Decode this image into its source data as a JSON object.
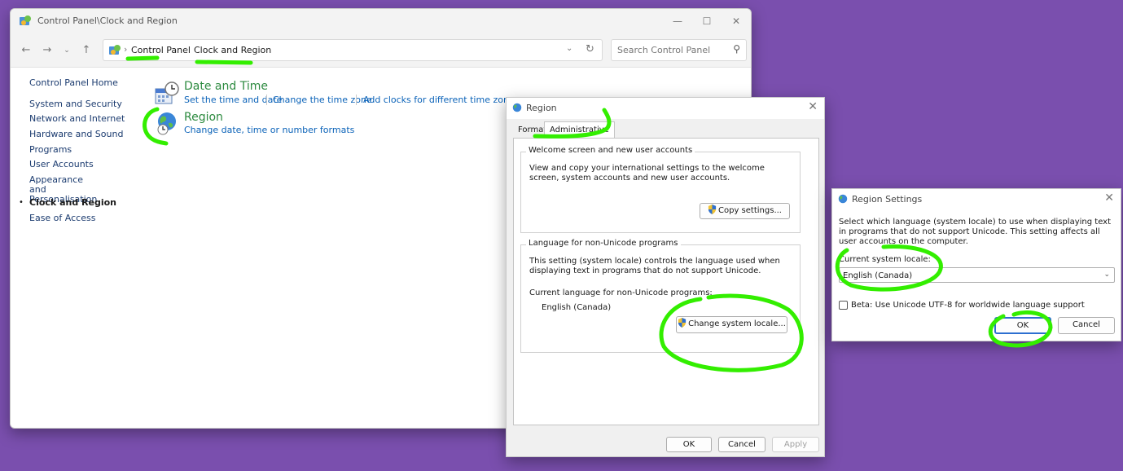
{
  "control_panel": {
    "window_title": "Control Panel\\Clock and Region",
    "breadcrumb": [
      "Control Panel",
      "Clock and Region"
    ],
    "search_placeholder": "Search Control Panel",
    "sidebar": {
      "home": "Control Panel Home",
      "items": [
        {
          "label": "System and Security"
        },
        {
          "label": "Network and Internet"
        },
        {
          "label": "Hardware and Sound"
        },
        {
          "label": "Programs"
        },
        {
          "label": "User Accounts"
        },
        {
          "label": "Appearance and Personalisation"
        },
        {
          "label": "Clock and Region"
        },
        {
          "label": "Ease of Access"
        }
      ]
    },
    "categories": [
      {
        "title": "Date and Time",
        "links": [
          "Set the time and date",
          "Change the time zone",
          "Add clocks for different time zones"
        ]
      },
      {
        "title": "Region",
        "links": [
          "Change date, time or number formats"
        ]
      }
    ]
  },
  "region_dialog": {
    "title": "Region",
    "tabs": [
      "Formats",
      "Administrative"
    ],
    "welcome_group": {
      "legend": "Welcome screen and new user accounts",
      "text": "View and copy your international settings to the welcome screen, system accounts and new user accounts.",
      "button": "Copy settings..."
    },
    "unicode_group": {
      "legend": "Language for non-Unicode programs",
      "text": "This setting (system locale) controls the language used when displaying text in programs that do not support Unicode.",
      "current_label": "Current language for non-Unicode programs:",
      "current_value": "English (Canada)",
      "button": "Change system locale..."
    },
    "buttons": {
      "ok": "OK",
      "cancel": "Cancel",
      "apply": "Apply"
    }
  },
  "region_settings": {
    "title": "Region Settings",
    "description": "Select which language (system locale) to use when displaying text in programs that do not support Unicode. This setting affects all user accounts on the computer.",
    "locale_label": "Current system locale:",
    "locale_value": "English (Canada)",
    "beta_label": "Beta: Use Unicode UTF-8 for worldwide language support",
    "ok": "OK",
    "cancel": "Cancel"
  },
  "colors": {
    "desktop": "#7a4fae",
    "category_title": "#2c8a3f",
    "link": "#0a62b8",
    "highlight": "#33ee00"
  }
}
